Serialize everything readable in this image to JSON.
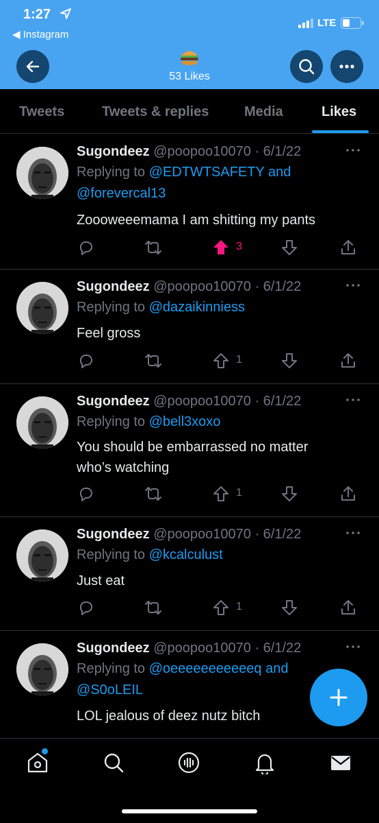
{
  "status_bar": {
    "time": "1:27",
    "back_app": "◀ Instagram",
    "network": "LTE"
  },
  "header": {
    "emoji": "🍔",
    "likes_label": "53 Likes"
  },
  "tabs": [
    {
      "label": "Tweets",
      "active": false
    },
    {
      "label": "Tweets & replies",
      "active": false
    },
    {
      "label": "Media",
      "active": false
    },
    {
      "label": "Likes",
      "active": true
    }
  ],
  "tweets": [
    {
      "name": "Sugondeez",
      "handle_date": "@poopoo10070 · 6/1/22",
      "replying_prefix": "Replying to ",
      "replying_line1": "@EDTWTSAFETY and",
      "replying_line2": "@forevercal13",
      "text": "Zoooweeemama I am shitting my pants",
      "upvotes": "3",
      "upvoted": true
    },
    {
      "name": "Sugondeez",
      "handle_date": "@poopoo10070 · 6/1/22",
      "replying_prefix": "Replying to ",
      "replying_line1": "@dazaikinniess",
      "text": "Feel gross",
      "upvotes": "1",
      "upvoted": false
    },
    {
      "name": "Sugondeez",
      "handle_date": "@poopoo10070 · 6/1/22",
      "replying_prefix": "Replying to ",
      "replying_line1": "@bell3xoxo",
      "text_line1": "You should be embarrassed no matter",
      "text_line2": "who’s watching",
      "upvotes": "1",
      "upvoted": false
    },
    {
      "name": "Sugondeez",
      "handle_date": "@poopoo10070 · 6/1/22",
      "replying_prefix": "Replying to ",
      "replying_line1": "@kcalculust",
      "text": "Just eat",
      "upvotes": "1",
      "upvoted": false
    },
    {
      "name": "Sugondeez",
      "handle_date": "@poopoo10070 · 6/1/22",
      "replying_prefix": "Replying to ",
      "replying_line1": "@oeeeeeeeeeeeq and",
      "replying_line2": "@S0oLEIL",
      "text": "LOL jealous of deez nutz bitch"
    }
  ],
  "colors": {
    "header_blue": "#48a4f1",
    "accent": "#1d9bf0",
    "like_pink": "#f91880",
    "muted": "#71767b"
  },
  "icons": [
    "back-arrow-icon",
    "search-icon",
    "more-icon",
    "reply-icon",
    "retweet-icon",
    "upvote-icon",
    "downvote-icon",
    "share-icon",
    "compose-plus-icon",
    "home-icon",
    "explore-icon",
    "spaces-icon",
    "notifications-icon",
    "messages-icon"
  ]
}
